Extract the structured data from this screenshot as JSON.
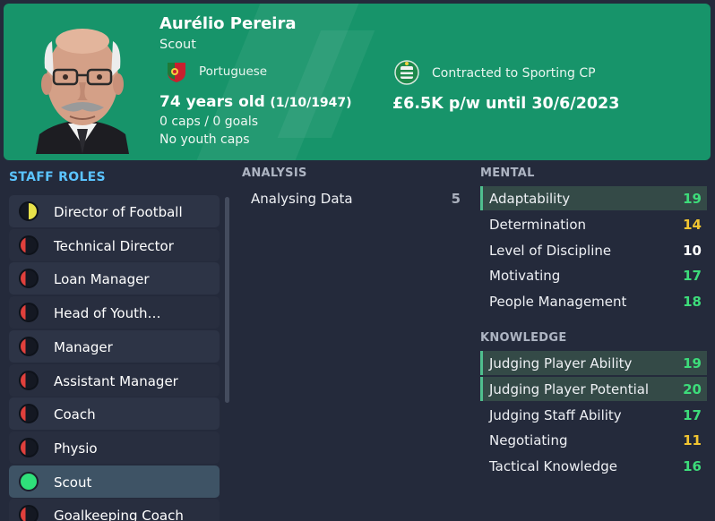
{
  "header": {
    "name": "Aurélio Pereira",
    "role": "Scout",
    "nationality": "Portuguese",
    "contract": "Contracted to Sporting CP",
    "age": "74 years old",
    "dob": "(1/10/1947)",
    "caps": "0 caps / 0 goals",
    "youth_caps": "No youth caps",
    "wage": "£6.5K p/w until 30/6/2023",
    "flag_icon": "portugal-flag-icon",
    "club_icon": "sporting-cp-badge-icon"
  },
  "staff_roles": {
    "title": "STAFF ROLES",
    "items": [
      {
        "label": "Director of Football",
        "state": "partial"
      },
      {
        "label": "Technical Director",
        "state": "low"
      },
      {
        "label": "Loan Manager",
        "state": "low"
      },
      {
        "label": "Head of Youth…",
        "state": "low"
      },
      {
        "label": "Manager",
        "state": "low"
      },
      {
        "label": "Assistant Manager",
        "state": "low"
      },
      {
        "label": "Coach",
        "state": "low"
      },
      {
        "label": "Physio",
        "state": "low"
      },
      {
        "label": "Scout",
        "state": "full"
      },
      {
        "label": "Goalkeeping Coach",
        "state": "low"
      }
    ]
  },
  "analysis": {
    "title": "ANALYSIS",
    "items": [
      {
        "name": "Analysing Data",
        "value": "5"
      }
    ]
  },
  "mental": {
    "title": "MENTAL",
    "items": [
      {
        "name": "Adaptability",
        "value": "19",
        "highlight": true
      },
      {
        "name": "Determination",
        "value": "14",
        "highlight": false
      },
      {
        "name": "Level of Discipline",
        "value": "10",
        "highlight": false
      },
      {
        "name": "Motivating",
        "value": "17",
        "highlight": false
      },
      {
        "name": "People Management",
        "value": "18",
        "highlight": false
      }
    ]
  },
  "knowledge": {
    "title": "KNOWLEDGE",
    "items": [
      {
        "name": "Judging Player Ability",
        "value": "19",
        "highlight": true
      },
      {
        "name": "Judging Player Potential",
        "value": "20",
        "highlight": true
      },
      {
        "name": "Judging Staff Ability",
        "value": "17",
        "highlight": false
      },
      {
        "name": "Negotiating",
        "value": "11",
        "highlight": false
      },
      {
        "name": "Tactical Knowledge",
        "value": "16",
        "highlight": false
      }
    ]
  },
  "colors": {
    "header_green": "#17946a",
    "accent_blue": "#5bc4ff",
    "value_green": "#3ddc7a",
    "value_yellow": "#f2c531",
    "value_white": "#ffffff",
    "value_grey": "#aab0bd"
  }
}
